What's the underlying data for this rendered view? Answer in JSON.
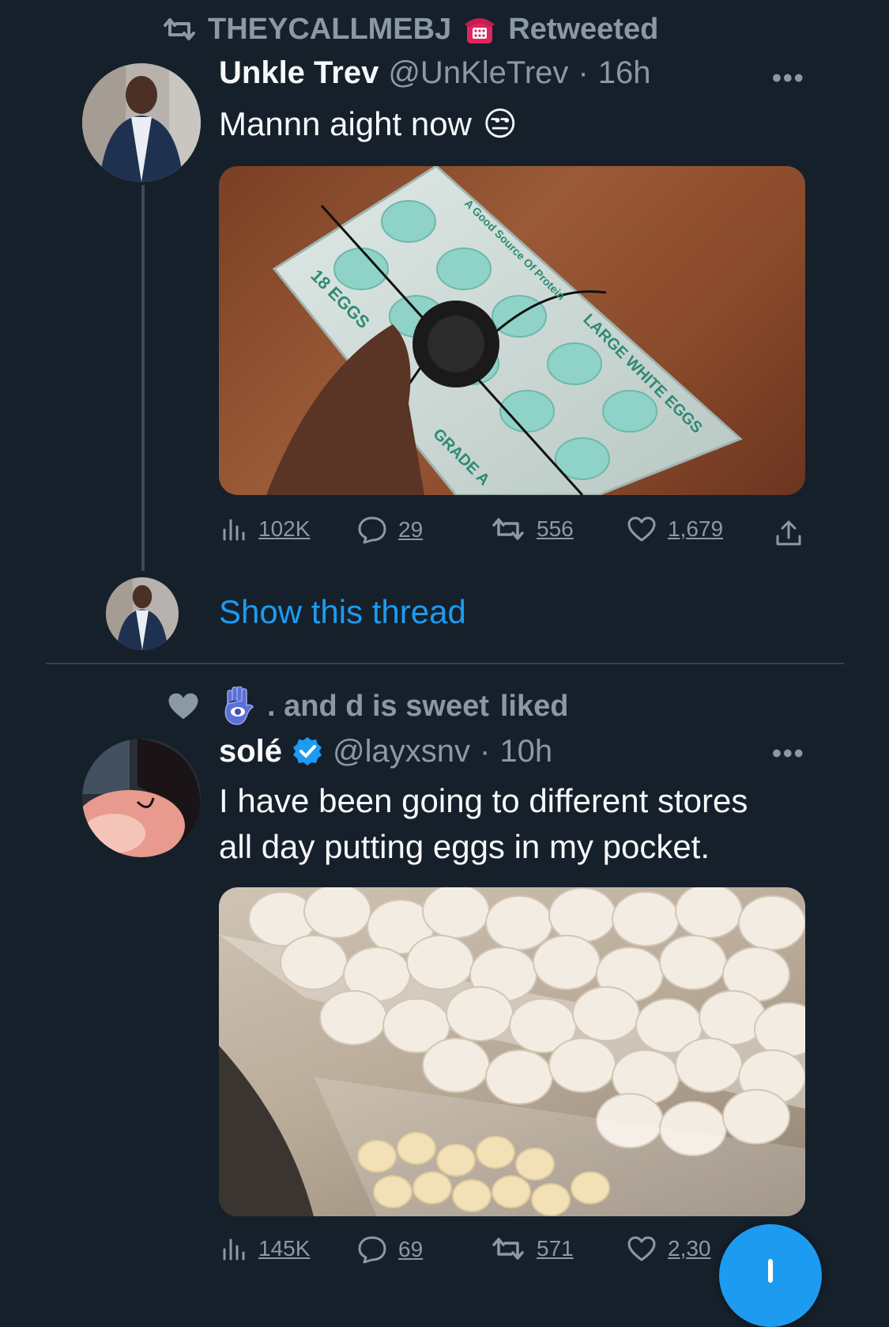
{
  "tweet1": {
    "social_context": {
      "user": "THEYCALLMEBJ",
      "action": "Retweeted"
    },
    "author": {
      "name": "Unkle Trev",
      "handle": "@UnKleTrev",
      "time": "16h"
    },
    "text": "Mannn aight now",
    "emoji": "😒",
    "image_alt_words": {
      "left": "18 EGGS",
      "top": "A Good Source Of Protein",
      "right": "LARGE WHITE EGGS",
      "bottom": "GRADE A"
    },
    "stats": {
      "views": "102K",
      "replies": "29",
      "retweets": "556",
      "likes": "1,679"
    },
    "show_thread": "Show this thread"
  },
  "tweet2": {
    "social_context": {
      "user": ". and d is sweet",
      "action": "liked"
    },
    "author": {
      "name": "solé",
      "handle": "@layxsnv",
      "time": "10h",
      "verified": true
    },
    "text_line1": "I have been going to different stores",
    "text_line2": "all day putting eggs in my pocket.",
    "stats": {
      "views": "145K",
      "replies": "69",
      "retweets": "571",
      "likes": "2,30"
    }
  },
  "colors": {
    "background": "#15202b",
    "accent": "#1d9bf0",
    "muted": "#8b98a5"
  },
  "icons": [
    "retweet-icon",
    "telephone-icon",
    "more-icon",
    "views-icon",
    "reply-icon",
    "like-icon",
    "share-icon",
    "hamsa-icon",
    "verified-icon",
    "compose-icon"
  ]
}
